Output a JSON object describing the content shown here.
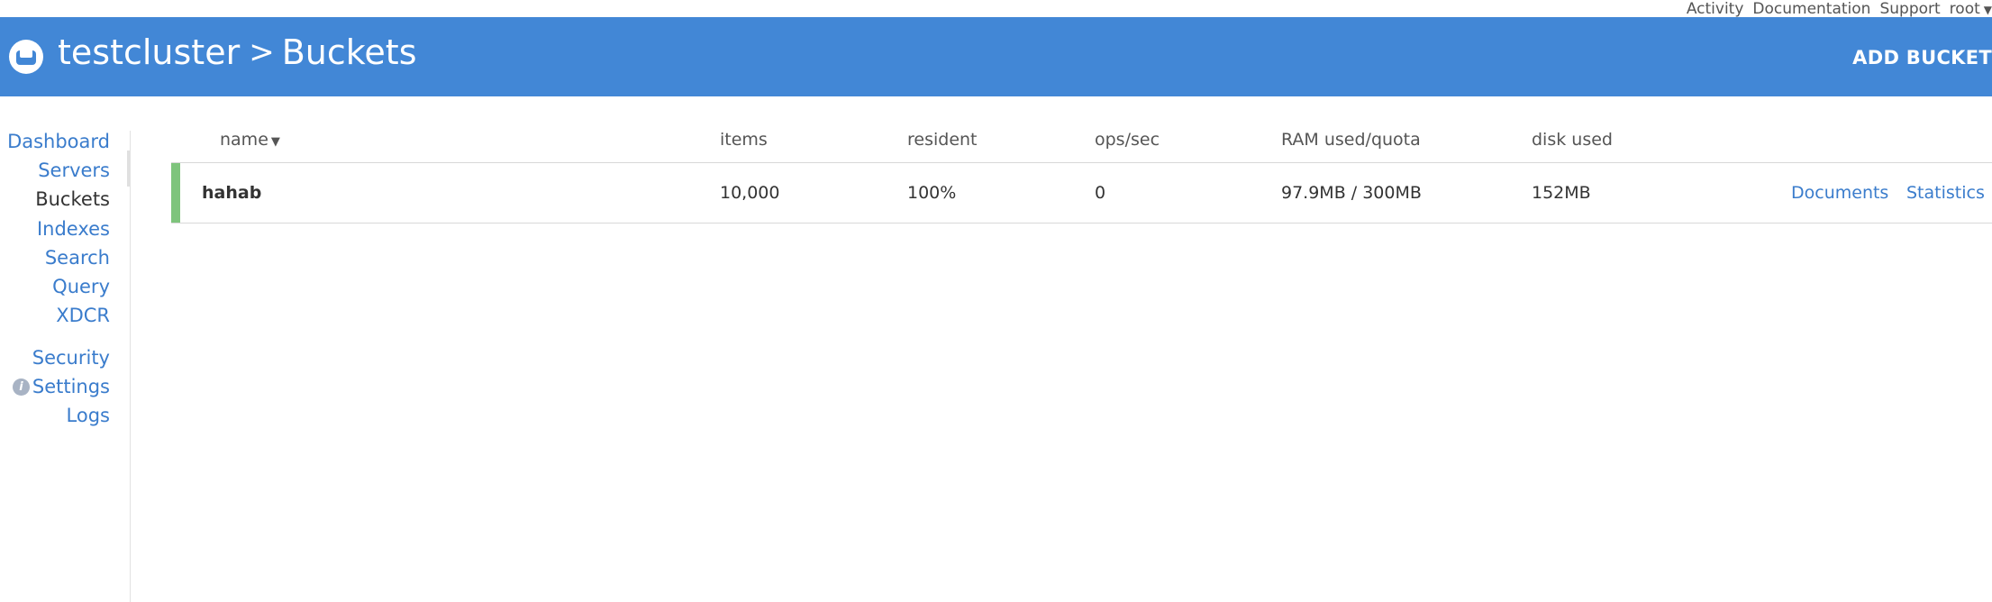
{
  "top_links": {
    "activity": "Activity",
    "documentation": "Documentation",
    "support": "Support",
    "user": "root"
  },
  "header": {
    "cluster": "testcluster",
    "separator": ">",
    "page": "Buckets",
    "add_bucket": "ADD BUCKET"
  },
  "sidebar": {
    "items": [
      {
        "label": "Dashboard"
      },
      {
        "label": "Servers"
      },
      {
        "label": "Buckets"
      },
      {
        "label": "Indexes"
      },
      {
        "label": "Search"
      },
      {
        "label": "Query"
      },
      {
        "label": "XDCR"
      },
      {
        "label": "Security"
      },
      {
        "label": "Settings"
      },
      {
        "label": "Logs"
      }
    ],
    "active": "Buckets",
    "settings_badge": "i"
  },
  "table": {
    "columns": [
      "name",
      "items",
      "resident",
      "ops/sec",
      "RAM used/quota",
      "disk used"
    ],
    "sort_column": "name",
    "rows": [
      {
        "name": "hahab",
        "items": "10,000",
        "resident": "100%",
        "ops_sec": "0",
        "ram": "97.9MB / 300MB",
        "disk": "152MB",
        "links": [
          "Documents",
          "Statistics"
        ],
        "status_color": "#7ec47c"
      }
    ]
  },
  "colors": {
    "header_bg": "#4287d6",
    "link": "#3a7ccc",
    "healthy": "#7ec47c"
  }
}
